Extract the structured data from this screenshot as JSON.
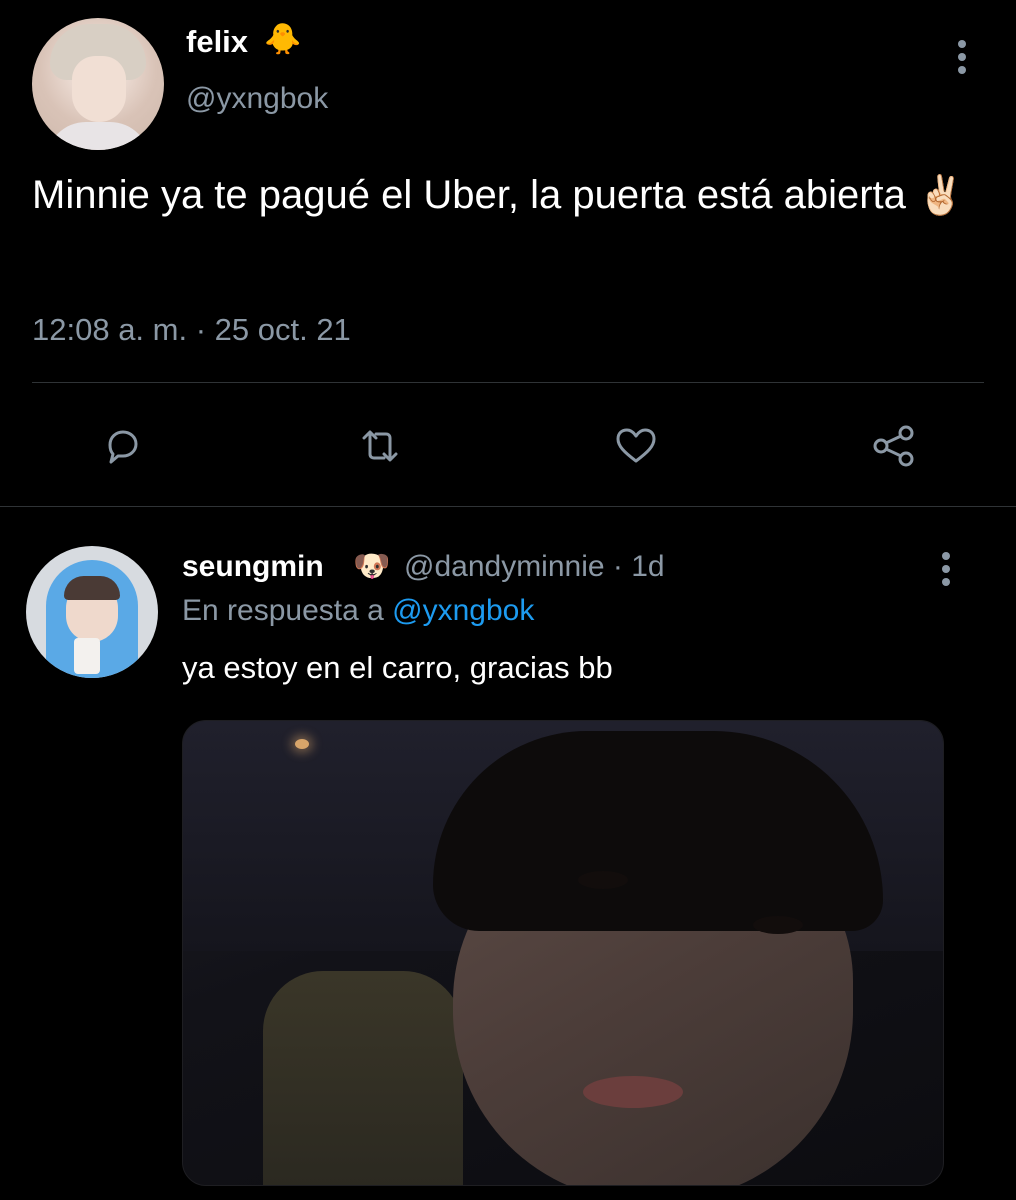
{
  "main_tweet": {
    "author_name": "felix",
    "author_emoji": "🐥",
    "author_handle": "@yxngbok",
    "text": "Minnie ya te pagué el Uber, la puerta está abierta",
    "text_emoji": "✌🏻",
    "timestamp": "12:08 a. m. · 25 oct. 21",
    "menu_icon": "more-vertical-icon",
    "actions": [
      {
        "name": "reply",
        "icon": "speech-bubble-icon"
      },
      {
        "name": "retweet",
        "icon": "retweet-arrows-icon"
      },
      {
        "name": "like",
        "icon": "heart-icon"
      },
      {
        "name": "share",
        "icon": "share-nodes-icon"
      }
    ]
  },
  "reply_tweet": {
    "author_name": "seungmin",
    "author_emoji": "🐶",
    "author_handle": "@dandyminnie",
    "age": "· 1d",
    "reply_prefix": "En respuesta a",
    "reply_mention": "@yxngbok",
    "text": "ya estoy en el carro, gracias bb",
    "menu_icon": "more-vertical-icon",
    "has_photo": true
  },
  "colors": {
    "background": "#000000",
    "primary_text": "#ffffff",
    "secondary_text": "#8b98a5",
    "mention": "#1d9bf0",
    "divider": "#2f3336"
  }
}
